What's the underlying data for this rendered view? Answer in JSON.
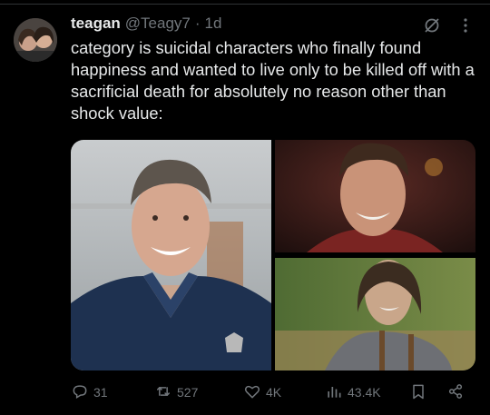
{
  "tweet": {
    "author_name": "teagan",
    "author_handle": "@Teagy7",
    "separator": "·",
    "time": "1d",
    "text": "category is suicidal characters who finally found happiness and wanted to live only to be killed off with a sacrificial death for absolutely no reason other than shock value:"
  },
  "actions": {
    "replies": "31",
    "retweets": "527",
    "likes": "4K",
    "views": "43.4K"
  },
  "icons": {
    "avatar": "avatar",
    "grok": "grok-icon",
    "more": "more-dots-icon",
    "reply": "reply-icon",
    "retweet": "retweet-icon",
    "like": "heart-icon",
    "views": "views-chart-icon",
    "bookmark": "bookmark-icon",
    "share": "share-icon"
  },
  "colors": {
    "background": "#000000",
    "text": "#e7e9ea",
    "muted": "#71767b"
  }
}
